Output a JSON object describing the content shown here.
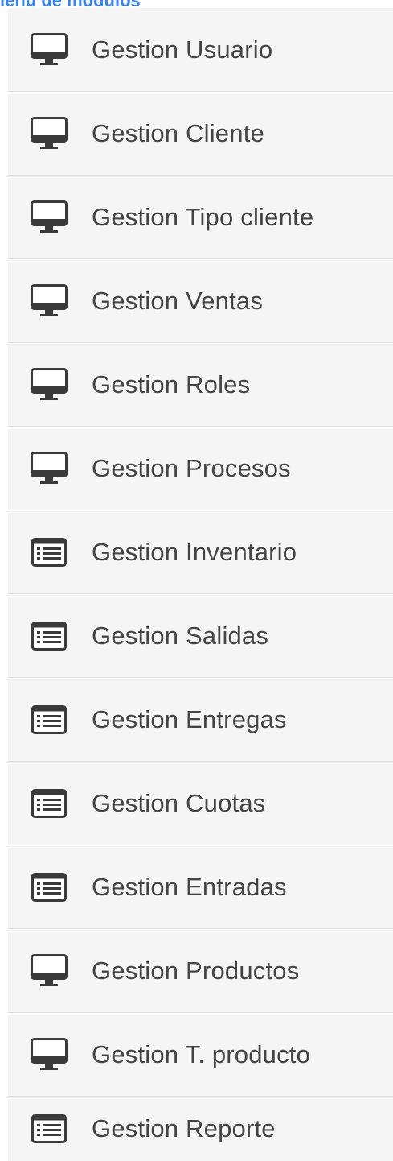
{
  "header": {
    "title": "ienú de módulos"
  },
  "menu": {
    "items": [
      {
        "label": "Gestion Usuario",
        "icon": "monitor-icon"
      },
      {
        "label": "Gestion Cliente",
        "icon": "monitor-icon"
      },
      {
        "label": "Gestion Tipo cliente",
        "icon": "monitor-icon"
      },
      {
        "label": "Gestion Ventas",
        "icon": "monitor-icon"
      },
      {
        "label": "Gestion Roles",
        "icon": "monitor-icon"
      },
      {
        "label": "Gestion Procesos",
        "icon": "monitor-icon"
      },
      {
        "label": "Gestion Inventario",
        "icon": "list-icon"
      },
      {
        "label": "Gestion Salidas",
        "icon": "list-icon"
      },
      {
        "label": "Gestion Entregas",
        "icon": "list-icon"
      },
      {
        "label": "Gestion Cuotas",
        "icon": "list-icon"
      },
      {
        "label": "Gestion Entradas",
        "icon": "list-icon"
      },
      {
        "label": "Gestion Productos",
        "icon": "monitor-icon"
      },
      {
        "label": "Gestion T. producto",
        "icon": "monitor-icon"
      },
      {
        "label": "Gestion Reporte",
        "icon": "list-icon"
      }
    ]
  },
  "colors": {
    "header_text": "#3b83e6",
    "item_background": "#f5f5f5",
    "item_divider": "#e0e0e0",
    "item_text": "#444444",
    "icon": "#3a3a3a"
  }
}
